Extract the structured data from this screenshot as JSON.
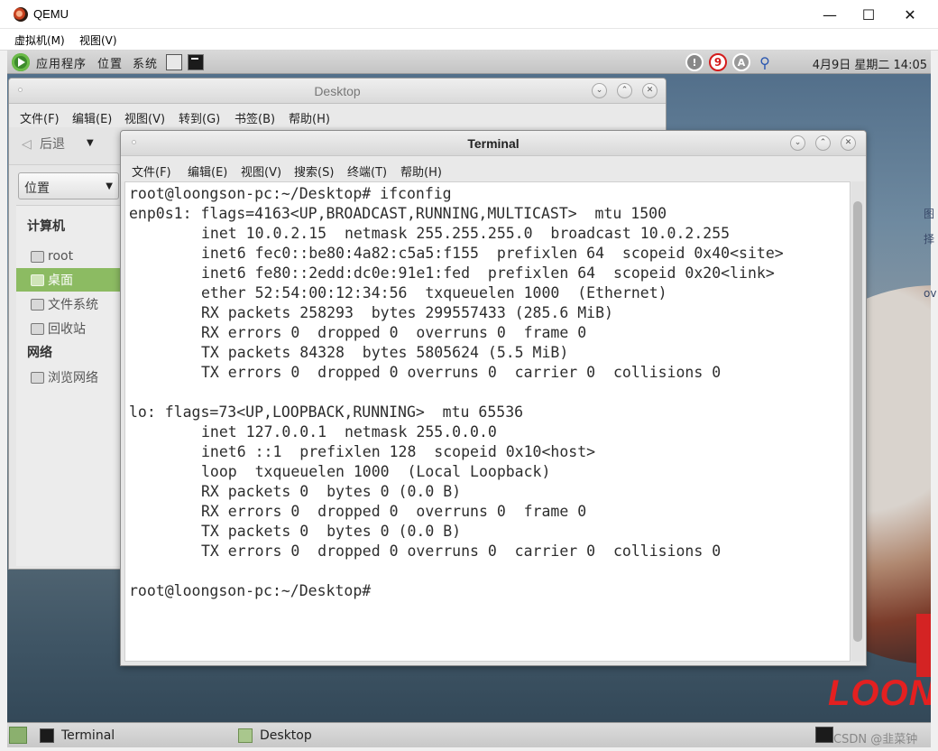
{
  "qemu": {
    "title": "QEMU",
    "controls": {
      "minimize": "—",
      "maximize": "☐",
      "close": "✕"
    },
    "menu": [
      "虚拟机(M)",
      "视图(V)"
    ]
  },
  "top_panel": {
    "menus": [
      "应用程序",
      "位置",
      "系统"
    ],
    "tray": {
      "info": "!",
      "badge": "9",
      "input": "A"
    },
    "clock": "4月9日 星期二 14:05"
  },
  "desktop_window": {
    "title": "Desktop",
    "menu": [
      "文件(F)",
      "编辑(E)",
      "视图(V)",
      "转到(G)",
      "书签(B)",
      "帮助(H)"
    ],
    "back_label": "后退",
    "location_combo": "位置",
    "sidebar": {
      "computer_header": "计算机",
      "computer_items": [
        "root",
        "桌面",
        "文件系统",
        "回收站"
      ],
      "network_header": "网络",
      "network_items": [
        "浏览网络"
      ]
    }
  },
  "terminal": {
    "title": "Terminal",
    "menu": [
      "文件(F)",
      "编辑(E)",
      "视图(V)",
      "搜索(S)",
      "终端(T)",
      "帮助(H)"
    ],
    "lines": [
      {
        "indent": false,
        "text": "root@loongson-pc:~/Desktop# ifconfig"
      },
      {
        "indent": false,
        "text": "enp0s1: flags=4163<UP,BROADCAST,RUNNING,MULTICAST>  mtu 1500"
      },
      {
        "indent": true,
        "text": "inet 10.0.2.15  netmask 255.255.255.0  broadcast 10.0.2.255"
      },
      {
        "indent": true,
        "text": "inet6 fec0::be80:4a82:c5a5:f155  prefixlen 64  scopeid 0x40<site>"
      },
      {
        "indent": true,
        "text": "inet6 fe80::2edd:dc0e:91e1:fed  prefixlen 64  scopeid 0x20<link>"
      },
      {
        "indent": true,
        "text": "ether 52:54:00:12:34:56  txqueuelen 1000  (Ethernet)"
      },
      {
        "indent": true,
        "text": "RX packets 258293  bytes 299557433 (285.6 MiB)"
      },
      {
        "indent": true,
        "text": "RX errors 0  dropped 0  overruns 0  frame 0"
      },
      {
        "indent": true,
        "text": "TX packets 84328  bytes 5805624 (5.5 MiB)"
      },
      {
        "indent": true,
        "text": "TX errors 0  dropped 0 overruns 0  carrier 0  collisions 0"
      },
      {
        "indent": false,
        "text": ""
      },
      {
        "indent": false,
        "text": "lo: flags=73<UP,LOOPBACK,RUNNING>  mtu 65536"
      },
      {
        "indent": true,
        "text": "inet 127.0.0.1  netmask 255.0.0.0"
      },
      {
        "indent": true,
        "text": "inet6 ::1  prefixlen 128  scopeid 0x10<host>"
      },
      {
        "indent": true,
        "text": "loop  txqueuelen 1000  (Local Loopback)"
      },
      {
        "indent": true,
        "text": "RX packets 0  bytes 0 (0.0 B)"
      },
      {
        "indent": true,
        "text": "RX errors 0  dropped 0  overruns 0  frame 0"
      },
      {
        "indent": true,
        "text": "TX packets 0  bytes 0 (0.0 B)"
      },
      {
        "indent": true,
        "text": "TX errors 0  dropped 0 overruns 0  carrier 0  collisions 0"
      },
      {
        "indent": false,
        "text": ""
      },
      {
        "indent": false,
        "text": "root@loongson-pc:~/Desktop#"
      }
    ]
  },
  "taskbar": {
    "tasks": [
      "Terminal",
      "Desktop"
    ],
    "watermark": "CSDN @韭菜钟"
  },
  "wallpaper": {
    "brand_text": "LOON"
  },
  "side_hints": [
    "图",
    "择",
    "ov"
  ],
  "colors": {
    "sidebar_active": "#8cbb62",
    "tray_badge": "#d41c1c",
    "brand_red": "#e42020"
  }
}
